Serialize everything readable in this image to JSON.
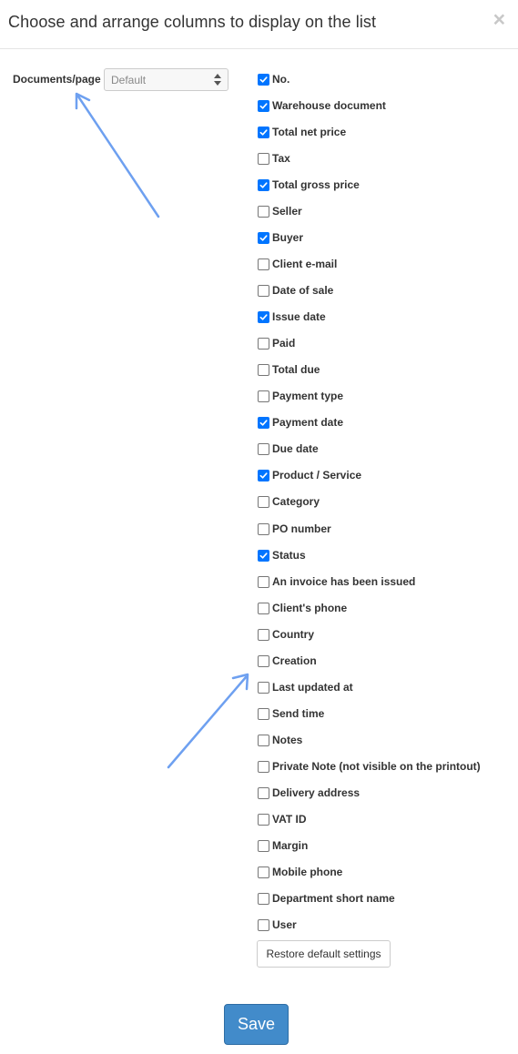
{
  "dialog": {
    "title": "Choose and arrange columns to display on the list",
    "close_icon": "×"
  },
  "per_page": {
    "label": "Documents/page",
    "selected": "Default"
  },
  "columns": [
    {
      "label": "No.",
      "checked": true
    },
    {
      "label": "Warehouse document",
      "checked": true
    },
    {
      "label": "Total net price",
      "checked": true
    },
    {
      "label": "Tax",
      "checked": false
    },
    {
      "label": "Total gross price",
      "checked": true
    },
    {
      "label": "Seller",
      "checked": false
    },
    {
      "label": "Buyer",
      "checked": true
    },
    {
      "label": "Client e-mail",
      "checked": false
    },
    {
      "label": "Date of sale",
      "checked": false
    },
    {
      "label": "Issue date",
      "checked": true
    },
    {
      "label": "Paid",
      "checked": false
    },
    {
      "label": "Total due",
      "checked": false
    },
    {
      "label": "Payment type",
      "checked": false
    },
    {
      "label": "Payment date",
      "checked": true
    },
    {
      "label": "Due date",
      "checked": false
    },
    {
      "label": "Product / Service",
      "checked": true
    },
    {
      "label": "Category",
      "checked": false
    },
    {
      "label": "PO number",
      "checked": false
    },
    {
      "label": "Status",
      "checked": true
    },
    {
      "label": "An invoice has been issued",
      "checked": false
    },
    {
      "label": "Client's phone",
      "checked": false
    },
    {
      "label": "Country",
      "checked": false
    },
    {
      "label": "Creation",
      "checked": false
    },
    {
      "label": "Last updated at",
      "checked": false
    },
    {
      "label": "Send time",
      "checked": false
    },
    {
      "label": "Notes",
      "checked": false
    },
    {
      "label": "Private Note (not visible on the printout)",
      "checked": false
    },
    {
      "label": "Delivery address",
      "checked": false
    },
    {
      "label": "VAT ID",
      "checked": false
    },
    {
      "label": "Margin",
      "checked": false
    },
    {
      "label": "Mobile phone",
      "checked": false
    },
    {
      "label": "Department short name",
      "checked": false
    },
    {
      "label": "User",
      "checked": false
    }
  ],
  "buttons": {
    "restore": "Restore default settings",
    "save": "Save"
  },
  "colors": {
    "checkbox_checked": "#0075ff",
    "save_button": "#428bca",
    "annotation_arrow": "#6ea0f0"
  }
}
